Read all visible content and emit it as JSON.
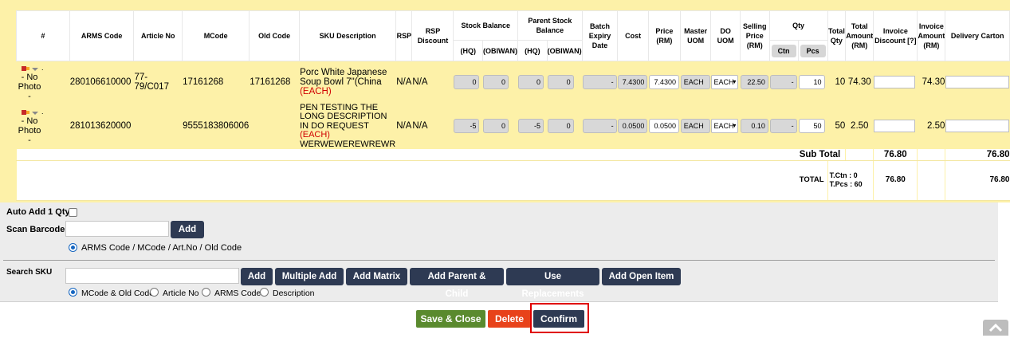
{
  "headers": {
    "num": "#",
    "arms_code": "ARMS Code",
    "article_no": "Article No",
    "mcode": "MCode",
    "old_code": "Old Code",
    "sku_desc": "SKU Description",
    "rsp": "RSP",
    "rsp_discount": "RSP Discount",
    "stock_balance": "Stock Balance",
    "parent_stock_balance": "Parent Stock Balance",
    "hq": "(HQ)",
    "obiwan": "(OBIWAN)",
    "batch_expiry": "Batch Expiry Date",
    "cost": "Cost",
    "price_rm": "Price (RM)",
    "master_uom": "Master UOM",
    "do_uom": "DO UOM",
    "selling_price": "Selling Price (RM)",
    "qty": "Qty",
    "ctn": "Ctn",
    "pcs": "Pcs",
    "total_qty": "Total Qty",
    "total_amount": "Total Amount (RM)",
    "invoice_discount": "Invoice Discount [?]",
    "invoice_amount": "Invoice Amount (RM)",
    "delivery_carton": "Delivery Carton"
  },
  "rows": [
    {
      "photo": "- No Photo -",
      "arms_code": "280106610000",
      "article_no": "77-79/C017",
      "mcode": "17161268",
      "old_code": "17161268",
      "desc": "Porc White Japanese Soup Bowl 7\"(China",
      "uom_tag": "(EACH)",
      "desc_extra": "",
      "rsp": "N/A",
      "rsp_discount": "N/A",
      "hq": "0",
      "obiwan": "0",
      "p_hq": "0",
      "p_obiwan": "0",
      "batch": "-",
      "cost": "7.4300",
      "price": "7.4300",
      "master_uom": "EACH",
      "do_uom": "EACH",
      "selling_price": "22.50",
      "ctn": "-",
      "pcs": "10",
      "total_qty": "10",
      "total_amount": "74.30",
      "invoice_amount": "74.30"
    },
    {
      "photo": "- No Photo -",
      "arms_code": "281013620000",
      "article_no": "",
      "mcode": "9555183806006",
      "old_code": "",
      "desc": "PEN TESTING THE LONG DESCRIPTION IN DO REQUEST",
      "uom_tag": "(EACH)",
      "desc_extra": "WERWEWEREWREWR",
      "rsp": "N/A",
      "rsp_discount": "N/A",
      "hq": "-5",
      "obiwan": "0",
      "p_hq": "-5",
      "p_obiwan": "0",
      "batch": "-",
      "cost": "0.0500",
      "price": "0.0500",
      "master_uom": "EACH",
      "do_uom": "EACH",
      "selling_price": "0.10",
      "ctn": "-",
      "pcs": "50",
      "total_qty": "50",
      "total_amount": "2.50",
      "invoice_amount": "2.50"
    }
  ],
  "subtotal": {
    "label": "Sub Total",
    "total_amount": "76.80",
    "invoice_amount": "76.80"
  },
  "total": {
    "label": "TOTAL",
    "qty_summary": "T.Ctn : 0 T.Pcs : 60",
    "total_amount": "76.80",
    "invoice_amount": "76.80"
  },
  "form": {
    "auto_add_label": "Auto Add 1 Qty",
    "scan_barcode_label": "Scan Barcode",
    "add_label": "Add",
    "scan_radio_label": "ARMS Code / MCode / Art.No / Old Code",
    "search_sku_label": "Search SKU",
    "search_buttons": [
      "Add",
      "Multiple Add",
      "Add Matrix",
      "Add Parent & Child",
      "Use Replacements",
      "Add Open Item"
    ],
    "search_radios": [
      "MCode & Old Code",
      "Article No",
      "ARMS Code",
      "Description"
    ]
  },
  "actions": {
    "save_close": "Save & Close",
    "delete": "Delete",
    "confirm": "Confirm"
  },
  "colors": {
    "navy": "#2e3a53",
    "green": "#5a8a2e",
    "red": "#e8421a",
    "highlight": "#e00000",
    "table_bg": "#fdf1a8"
  }
}
